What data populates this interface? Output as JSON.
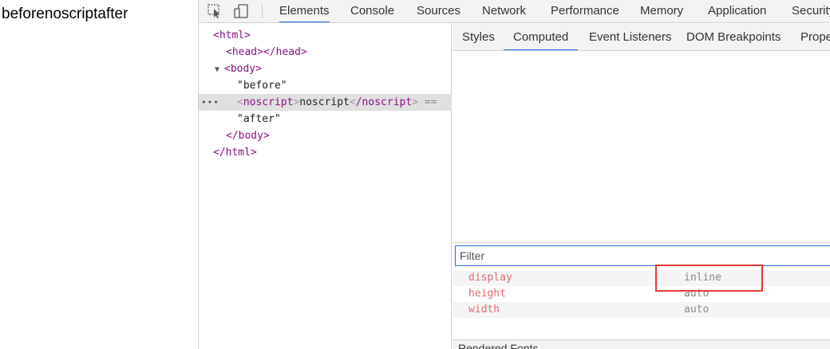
{
  "page": {
    "text": "beforenoscriptafter"
  },
  "toolbar": {
    "inspect_icon": "inspect-cursor-icon",
    "device_icon": "device-toggle-icon",
    "tabs": [
      {
        "label": "Elements",
        "active": true
      },
      {
        "label": "Console"
      },
      {
        "label": "Sources"
      },
      {
        "label": "Network"
      },
      {
        "label": "Performance"
      },
      {
        "label": "Memory"
      },
      {
        "label": "Application"
      },
      {
        "label": "Security"
      }
    ]
  },
  "dom": {
    "html_open": "<html>",
    "head": "<head></head>",
    "body_open": "<body>",
    "text_before": "\"before\"",
    "noscript_open_tag": "noscript",
    "noscript_text": "noscript",
    "noscript_close_tag": "/noscript",
    "eq_marker": "==",
    "text_after": "\"after\"",
    "body_close": "</body>",
    "html_close": "</html>"
  },
  "side_tabs": [
    {
      "label": "Styles"
    },
    {
      "label": "Computed",
      "active": true
    },
    {
      "label": "Event Listeners"
    },
    {
      "label": "DOM Breakpoints"
    },
    {
      "label": "Properties"
    }
  ],
  "filter": {
    "placeholder": "Filter"
  },
  "computed": [
    {
      "name": "display",
      "value": "inline"
    },
    {
      "name": "height",
      "value": "auto"
    },
    {
      "name": "width",
      "value": "auto"
    }
  ],
  "rendered_fonts": {
    "label": "Rendered Fonts"
  },
  "colors": {
    "accent": "#1a73e8",
    "highlight": "#e53935",
    "tag": "#881280",
    "prop": "#e06c75"
  }
}
